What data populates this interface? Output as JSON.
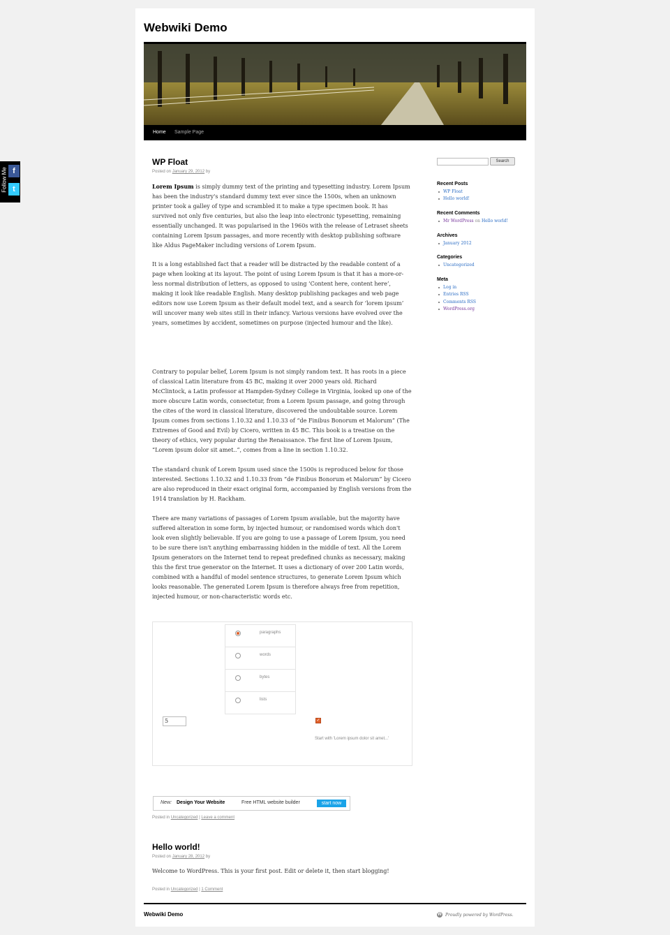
{
  "site": {
    "title": "Webwiki Demo"
  },
  "nav": {
    "items": [
      {
        "label": "Home"
      },
      {
        "label": "Sample Page"
      }
    ]
  },
  "posts": [
    {
      "title": "WP Float",
      "posted_prefix": "Posted on",
      "date": "January 29, 2012",
      "by": "by",
      "paragraphs": [
        {
          "bold": "Lorem Ipsum",
          "text": " is simply dummy text of the printing and typesetting industry. Lorem Ipsum has been the industry's standard dummy text ever since the 1500s, when an unknown printer took a galley of type and scrambled it to make a type specimen book. It has survived not only five centuries, but also the leap into electronic typesetting, remaining essentially unchanged. It was popularised in the 1960s with the release of Letraset sheets containing Lorem Ipsum passages, and more recently with desktop publishing software like Aldus PageMaker including versions of Lorem Ipsum."
        },
        {
          "text": "It is a long established fact that a reader will be distracted by the readable content of a page when looking at its layout. The point of using Lorem Ipsum is that it has a more-or-less normal distribution of letters, as opposed to using ‘Content here, content here’, making it look like readable English. Many desktop publishing packages and web page editors now use Lorem Ipsum as their default model text, and a search for ‘lorem ipsum’ will uncover many web sites still in their infancy. Various versions have evolved over the years, sometimes by accident, sometimes on purpose (injected humour and the like)."
        },
        {
          "text": "Contrary to popular belief, Lorem Ipsum is not simply random text. It has roots in a piece of classical Latin literature from 45 BC, making it over 2000 years old. Richard McClintock, a Latin professor at Hampden-Sydney College in Virginia, looked up one of the more obscure Latin words, consectetur, from a Lorem Ipsum passage, and going through the cites of the word in classical literature, discovered the undoubtable source. Lorem Ipsum comes from sections 1.10.32 and 1.10.33 of “de Finibus Bonorum et Malorum” (The Extremes of Good and Evil) by Cicero, written in 45 BC. This book is a treatise on the theory of ethics, very popular during the Renaissance. The first line of Lorem Ipsum, “Lorem ipsum dolor sit amet..”, comes from a line in section 1.10.32."
        },
        {
          "text": "The standard chunk of Lorem Ipsum used since the 1500s is reproduced below for those interested. Sections 1.10.32 and 1.10.33 from “de Finibus Bonorum et Malorum” by Cicero are also reproduced in their exact original form, accompanied by English versions from the 1914 translation by H. Rackham."
        },
        {
          "text": "There are many variations of passages of Lorem Ipsum available, but the majority have suffered alteration in some form, by injected humour, or randomised words which don't look even slightly believable. If you are going to use a passage of Lorem Ipsum, you need to be sure there isn't anything embarrassing hidden in the middle of text. All the Lorem Ipsum generators on the Internet tend to repeat predefined chunks as necessary, making this the first true generator on the Internet. It uses a dictionary of over 200 Latin words, combined with a handful of model sentence structures, to generate Lorem Ipsum which looks reasonable. The generated Lorem Ipsum is therefore always free from repetition, injected humour, or non-characteristic words etc."
        }
      ],
      "posted_in": "Posted in",
      "category": "Uncategorized",
      "separator": "|",
      "comment_link": "Leave a comment"
    },
    {
      "title": "Hello world!",
      "posted_prefix": "Posted on",
      "date": "January 28, 2012",
      "by": "by",
      "paragraphs": [
        {
          "text": "Welcome to WordPress. This is your first post. Edit or delete it, then start blogging!"
        }
      ],
      "posted_in": "Posted in",
      "category": "Uncategorized",
      "separator": "|",
      "comment_link": "1 Comment"
    }
  ],
  "lorem_form": {
    "options": [
      {
        "label": "paragraphs",
        "checked": true
      },
      {
        "label": "words",
        "checked": false
      },
      {
        "label": "bytes",
        "checked": false
      },
      {
        "label": "lists",
        "checked": false
      }
    ],
    "amount": "5",
    "start_with_checked": true,
    "start_label": "Start with 'Lorem ipsum dolor sit amet...'"
  },
  "ad": {
    "new_label": "New:",
    "headline": "Design Your Website",
    "tagline": "Free HTML website builder",
    "cta": "start now",
    "cta_color": "#1aa3e8"
  },
  "sidebar": {
    "search_button": "Search",
    "recent_posts": {
      "title": "Recent Posts",
      "items": [
        "WP Float",
        "Hello world!"
      ]
    },
    "recent_comments": {
      "title": "Recent Comments",
      "author": "Mr WordPress",
      "on": "on",
      "post": "Hello world!"
    },
    "archives": {
      "title": "Archives",
      "items": [
        "January 2012"
      ]
    },
    "categories": {
      "title": "Categories",
      "items": [
        "Uncategorized"
      ]
    },
    "meta": {
      "title": "Meta",
      "items": [
        "Log in",
        "Entries RSS",
        "Comments RSS",
        "WordPress.org"
      ]
    }
  },
  "footer": {
    "site_title": "Webwiki Demo",
    "powered": "Proudly powered by WordPress."
  },
  "follow": {
    "label": "Follow Me",
    "facebook_icon": "facebook-icon",
    "twitter_icon": "twitter-icon",
    "facebook_color": "#3b5998",
    "twitter_color": "#33ccff"
  },
  "colors": {
    "link": "#2a6cc4",
    "visited": "#743399",
    "accent_radio": "#e0612b"
  }
}
